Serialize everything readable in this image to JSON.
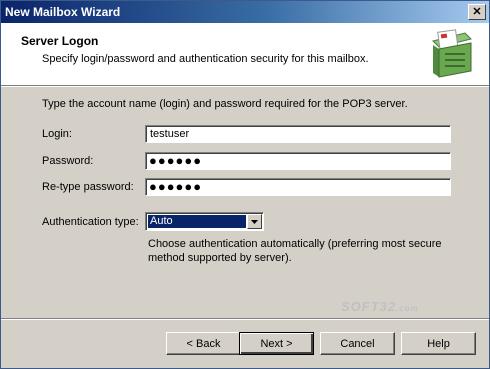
{
  "window": {
    "title": "New Mailbox Wizard",
    "close_glyph": "✕"
  },
  "header": {
    "title": "Server Logon",
    "subtitle": "Specify login/password and authentication security for this mailbox.",
    "icon": "mailbox-icon"
  },
  "form": {
    "instruction": "Type the account name (login) and password required for the POP3 server.",
    "login": {
      "label": "Login:",
      "value": "testuser"
    },
    "password": {
      "label": "Password:",
      "value": "●●●●●●"
    },
    "retype": {
      "label": "Re-type password:",
      "value": "●●●●●●"
    },
    "auth": {
      "label": "Authentication type:",
      "selected": "Auto",
      "description": "Choose authentication automatically (preferring most secure method supported by server)."
    }
  },
  "buttons": {
    "back": "< Back",
    "next": "Next >",
    "cancel": "Cancel",
    "help": "Help"
  },
  "watermark": {
    "main": "SOFT32",
    "suffix": ".com"
  },
  "colors": {
    "titlebar": "#0a246a",
    "face": "#d4d0c8",
    "selection": "#0a246a",
    "icon_green": "#6aa84f"
  }
}
